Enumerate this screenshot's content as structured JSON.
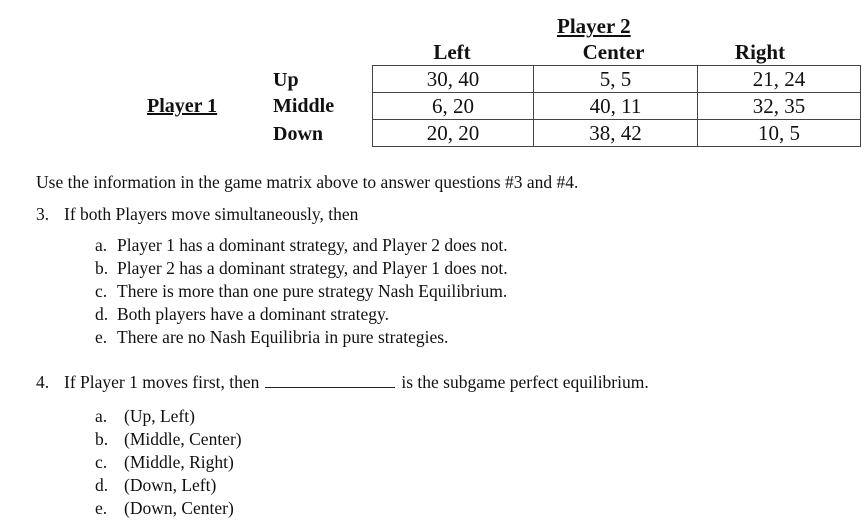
{
  "matrix": {
    "player2_label": "Player 2",
    "player1_label": "Player 1",
    "columns": [
      "Left",
      "Center",
      "Right"
    ],
    "rows": [
      {
        "label": "Up",
        "cells": [
          "30, 40",
          "5, 5",
          "21, 24"
        ]
      },
      {
        "label": "Middle",
        "cells": [
          "6, 20",
          "40, 11",
          "32, 35"
        ]
      },
      {
        "label": "Down",
        "cells": [
          "20, 20",
          "38, 42",
          "10, 5"
        ]
      }
    ]
  },
  "intro": "Use the information in the game matrix above to answer questions #3 and #4.",
  "questions": [
    {
      "number": "3.",
      "text": "If both Players move simultaneously, then",
      "options": [
        {
          "letter": "a.",
          "text": "Player 1 has a dominant strategy, and Player 2 does not."
        },
        {
          "letter": "b.",
          "text": "Player 2 has a dominant strategy, and Player 1 does not."
        },
        {
          "letter": "c.",
          "text": "There is more than one pure strategy Nash Equilibrium."
        },
        {
          "letter": "d.",
          "text": "Both players have a dominant strategy."
        },
        {
          "letter": "e.",
          "text": "There are no Nash Equilibria in pure strategies."
        }
      ]
    },
    {
      "number": "4.",
      "text_before": "If Player 1 moves first, then",
      "text_after": "is the subgame perfect equilibrium.",
      "options": [
        {
          "letter": "a.",
          "text": "(Up, Left)"
        },
        {
          "letter": "b.",
          "text": "(Middle, Center)"
        },
        {
          "letter": "c.",
          "text": "(Middle, Right)"
        },
        {
          "letter": "d.",
          "text": "(Down, Left)"
        },
        {
          "letter": "e.",
          "text": "(Down, Center)"
        }
      ]
    }
  ]
}
